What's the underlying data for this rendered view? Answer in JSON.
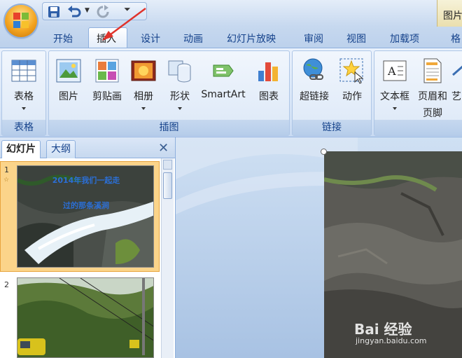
{
  "window": {
    "context_tab_title": "图片"
  },
  "tabs": [
    {
      "label": "开始"
    },
    {
      "label": "插入"
    },
    {
      "label": "设计"
    },
    {
      "label": "动画"
    },
    {
      "label": "幻灯片放映"
    },
    {
      "label": "审阅"
    },
    {
      "label": "视图"
    },
    {
      "label": "加载项"
    },
    {
      "label": "格"
    }
  ],
  "ribbon": {
    "groups": [
      {
        "label": "表格"
      },
      {
        "label": "插图"
      },
      {
        "label": "链接"
      },
      {
        "label": ""
      }
    ],
    "buttons": {
      "table": "表格",
      "picture": "图片",
      "clipart": "剪贴画",
      "album": "相册",
      "shapes": "形状",
      "smartart": "SmartArt",
      "chart": "图表",
      "hyperlink": "超链接",
      "action": "动作",
      "textbox": "文本框",
      "header_footer_1": "页眉和",
      "header_footer_2": "页脚",
      "art_partial": "艺"
    }
  },
  "slide_panel": {
    "tabs": [
      {
        "label": "幻灯片"
      },
      {
        "label": "大纲"
      }
    ],
    "close_glyph": "✕",
    "slides": [
      {
        "number": "1",
        "line1": "2014年我们一起走",
        "line2": "过的那条溪涧"
      },
      {
        "number": "2"
      }
    ]
  },
  "watermark": {
    "brand": "Bai 经验",
    "url": "jingyan.baidu.com"
  },
  "colors": {
    "accent": "#15428b",
    "selection": "#fbd48a",
    "arrow": "#e0332c"
  }
}
